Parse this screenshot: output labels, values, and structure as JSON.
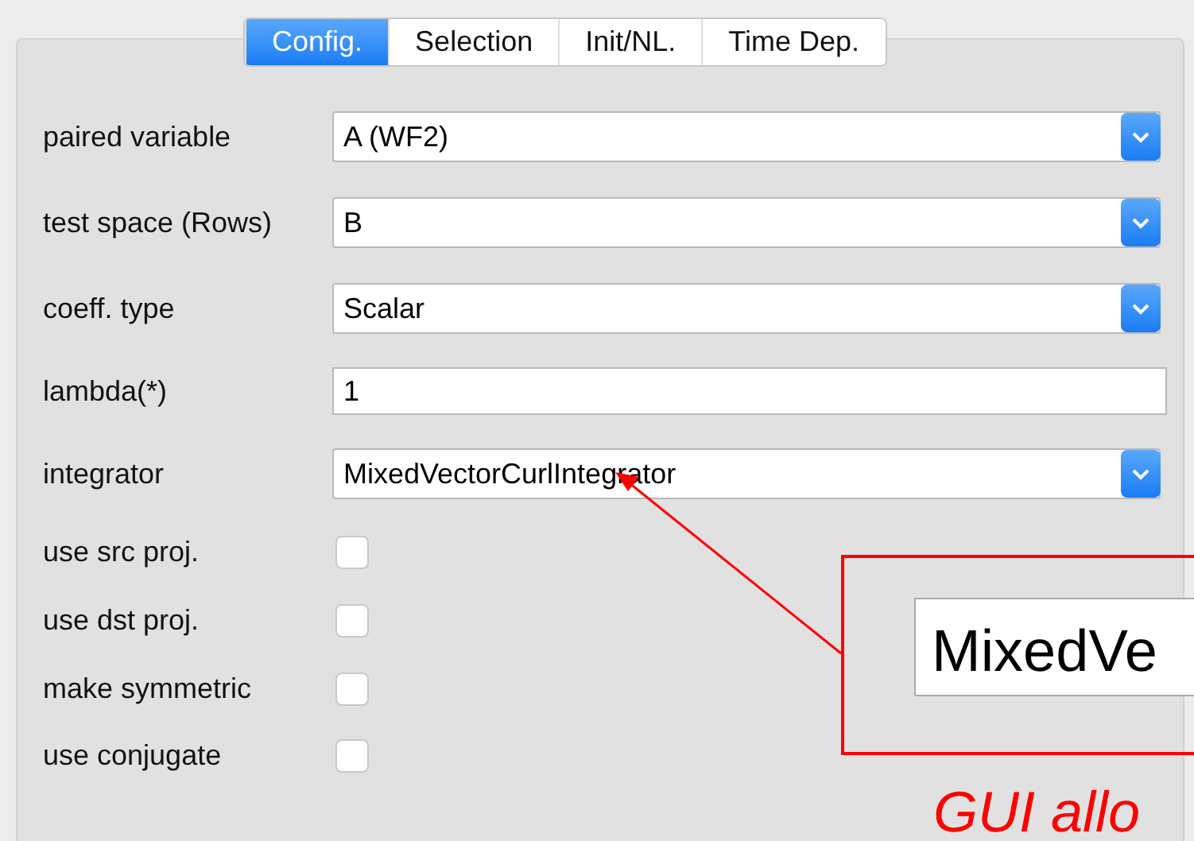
{
  "tabs": [
    {
      "label": "Config.",
      "selected": true
    },
    {
      "label": "Selection",
      "selected": false
    },
    {
      "label": "Init/NL.",
      "selected": false
    },
    {
      "label": "Time Dep.",
      "selected": false
    }
  ],
  "fields": [
    {
      "kind": "select",
      "label": "paired variable",
      "value": "A (WF2)"
    },
    {
      "kind": "select",
      "label": "test space (Rows)",
      "value": "B"
    },
    {
      "kind": "select",
      "label": "coeff. type",
      "value": "Scalar"
    },
    {
      "kind": "text",
      "label": "lambda(*)",
      "value": "1"
    },
    {
      "kind": "select",
      "label": "integrator",
      "value": "MixedVectorCurlIntegrator"
    },
    {
      "kind": "checkbox",
      "label": "use src proj.",
      "checked": false
    },
    {
      "kind": "checkbox",
      "label": "use dst proj.",
      "checked": false
    },
    {
      "kind": "checkbox",
      "label": "make symmetric",
      "checked": false
    },
    {
      "kind": "checkbox",
      "label": "use  conjugate",
      "checked": false
    }
  ],
  "callout": {
    "zoomed_text": "MixedVe",
    "caption": "GUI allo"
  }
}
